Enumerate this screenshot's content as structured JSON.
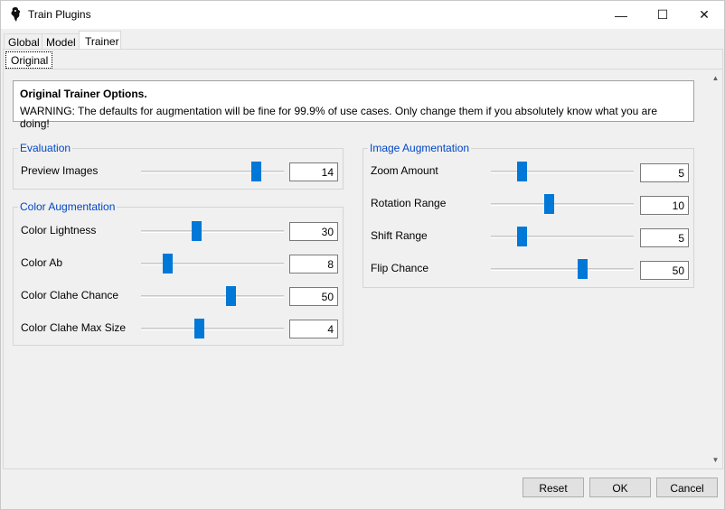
{
  "window": {
    "title": "Train Plugins",
    "minimize_glyph": "—",
    "maximize_glyph": "☐",
    "close_glyph": "✕"
  },
  "tabs": [
    {
      "label": "Global"
    },
    {
      "label": "Model"
    },
    {
      "label": "Trainer",
      "active": true
    }
  ],
  "subtab": {
    "label": "Original"
  },
  "info": {
    "title": "Original Trainer Options.",
    "warning": "WARNING: The defaults for augmentation will be fine for 99.9% of use cases. Only change them if you absolutely know what you are doing!"
  },
  "groups": {
    "evaluation": {
      "title": "Evaluation",
      "rows": [
        {
          "label": "Preview Images",
          "value": "14",
          "slider_fraction": 0.83
        }
      ]
    },
    "color_augmentation": {
      "title": "Color Augmentation",
      "rows": [
        {
          "label": "Color Lightness",
          "value": "30",
          "slider_fraction": 0.38
        },
        {
          "label": "Color Ab",
          "value": "8",
          "slider_fraction": 0.16
        },
        {
          "label": "Color Clahe Chance",
          "value": "50",
          "slider_fraction": 0.64
        },
        {
          "label": "Color Clahe Max Size",
          "value": "4",
          "slider_fraction": 0.4
        }
      ]
    },
    "image_augmentation": {
      "title": "Image Augmentation",
      "rows": [
        {
          "label": "Zoom Amount",
          "value": "5",
          "slider_fraction": 0.2
        },
        {
          "label": "Rotation Range",
          "value": "10",
          "slider_fraction": 0.4
        },
        {
          "label": "Shift Range",
          "value": "5",
          "slider_fraction": 0.2
        },
        {
          "label": "Flip Chance",
          "value": "50",
          "slider_fraction": 0.65
        }
      ]
    }
  },
  "buttons": {
    "reset": "Reset",
    "ok": "OK",
    "cancel": "Cancel"
  },
  "scrollbar": {
    "up_glyph": "▲",
    "down_glyph": "▼"
  },
  "colors": {
    "accent": "#0078d7",
    "group_title": "#0046c7"
  }
}
